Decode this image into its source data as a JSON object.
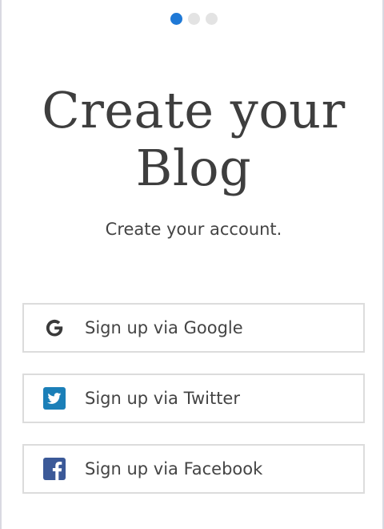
{
  "pagination": {
    "total": 3,
    "active_index": 0
  },
  "heading": {
    "line1": "Create your",
    "line2": "Blog"
  },
  "subheading": "Create your account.",
  "signup_buttons": [
    {
      "provider": "google",
      "label": "Sign up via Google",
      "icon": "google-icon"
    },
    {
      "provider": "twitter",
      "label": "Sign up via Twitter",
      "icon": "twitter-icon"
    },
    {
      "provider": "facebook",
      "label": "Sign up via Facebook",
      "icon": "facebook-icon"
    }
  ],
  "colors": {
    "accent": "#1f79d6",
    "dot_inactive": "#e3e3e3",
    "text": "#444444",
    "twitter": "#1b7fb8",
    "facebook": "#3b5998"
  }
}
